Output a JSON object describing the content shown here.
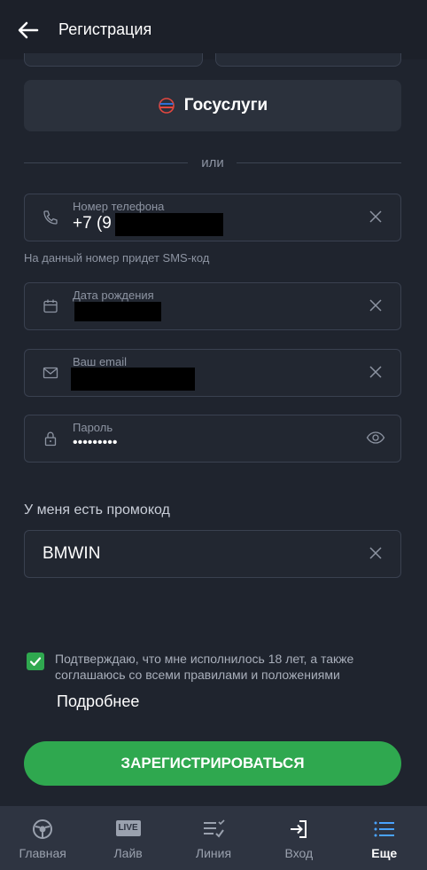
{
  "header": {
    "title": "Регистрация",
    "back_icon": "arrow-left-icon"
  },
  "gosuslugi": {
    "label": "Госуслуги",
    "icon": "gosuslugi-logo"
  },
  "divider": {
    "text": "или"
  },
  "fields": {
    "phone": {
      "label": "Номер телефона",
      "value": "+7 (9",
      "icon": "phone-icon",
      "hint": "На данный номер придет SMS-код"
    },
    "birthdate": {
      "label": "Дата рождения",
      "value": "",
      "icon": "calendar-icon"
    },
    "email": {
      "label": "Ваш email",
      "value": "",
      "icon": "mail-icon"
    },
    "password": {
      "label": "Пароль",
      "value": "•••••••••",
      "icon": "lock-icon"
    }
  },
  "promo": {
    "title": "У меня есть промокод",
    "value": "BMWIN"
  },
  "consent": {
    "checked": true,
    "text": "Подтверждаю, что мне исполнилось 18 лет, а также соглашаюсь со всеми правилами и положениями",
    "more": "Подробнее"
  },
  "register_button": "ЗАРЕГИСТРИРОВАТЬСЯ",
  "bottom_nav": [
    {
      "label": "Главная",
      "icon": "home-ball-icon",
      "active": false
    },
    {
      "label": "Лайв",
      "icon": "live-icon",
      "badge": "LIVE",
      "active": false
    },
    {
      "label": "Линия",
      "icon": "list-check-icon",
      "active": false
    },
    {
      "label": "Вход",
      "icon": "login-icon",
      "active": false
    },
    {
      "label": "Еще",
      "icon": "menu-icon",
      "active": true
    }
  ],
  "colors": {
    "accent_green": "#2fa84f",
    "active_blue": "#4aa3ff",
    "background": "#1f242e"
  }
}
